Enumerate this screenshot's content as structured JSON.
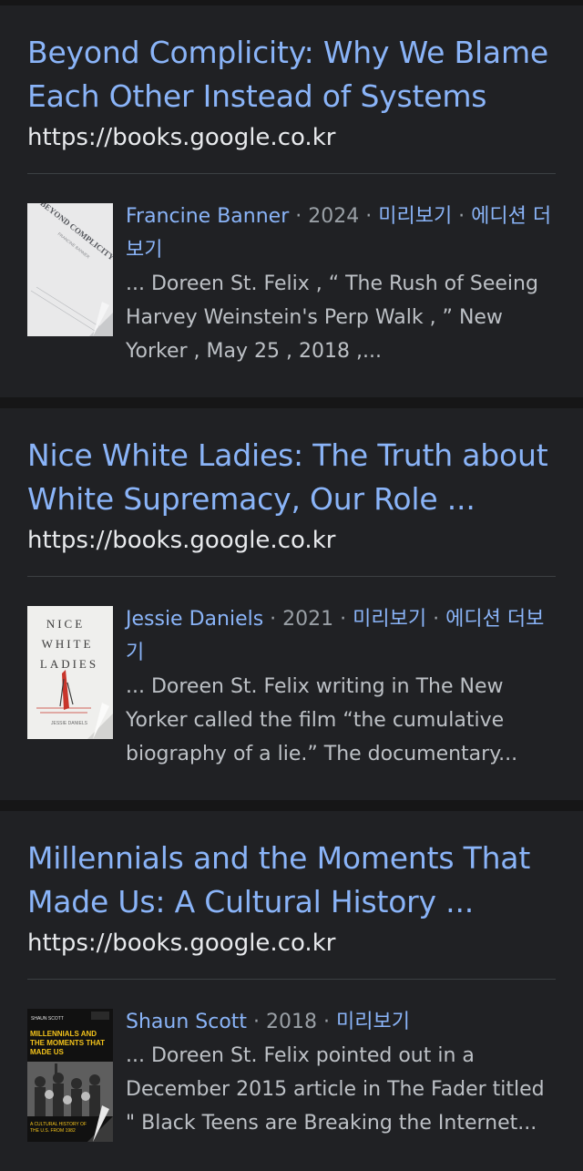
{
  "results": [
    {
      "title": "Beyond Complicity: Why We Blame Each Other Instead of Systems",
      "url": "https://books.google.co.kr",
      "author": "Francine Banner",
      "year": "2024",
      "preview_label": "미리보기",
      "editions_label": "에디션 더보기",
      "snippet": "... Doreen St. Felix , “ The Rush of Seeing Harvey Weinstein's Perp Walk , ” New Yorker , May 25 , 2018 ,...",
      "cover": {
        "title_text": "BEYOND COMPLICITY",
        "subtitle_text": "FRANCINE BANNER",
        "background": "#e9e9ea",
        "ink": "#55575c"
      }
    },
    {
      "title": "Nice White Ladies: The Truth about White Supremacy, Our Role ...",
      "url": "https://books.google.co.kr",
      "author": "Jessie Daniels",
      "year": "2021",
      "preview_label": "미리보기",
      "editions_label": "에디션 더보기",
      "snippet": "... Doreen St. Felix writing in The New Yorker called the film “the cumulative biography of a lie.” The documentary...",
      "cover": {
        "line1": "NICE",
        "line2": "WHITE",
        "line3": "LADIES",
        "author_text": "JESSIE DANIELS",
        "background": "#efefed",
        "ink": "#3b3b3b",
        "accent": "#c8352b"
      }
    },
    {
      "title": "Millennials and the Moments That Made Us: A Cultural History ...",
      "url": "https://books.google.co.kr",
      "author": "Shaun Scott",
      "year": "2018",
      "preview_label": "미리보기",
      "snippet": "... Doreen St. Felix pointed out in a December 2015 article in The Fader titled \" Black Teens are Breaking the Internet...",
      "cover": {
        "author_text": "SHAUN SCOTT",
        "title_lines": [
          "MILLENNIALS AND",
          "THE MOMENTS THAT",
          "MADE US"
        ],
        "footer_lines": [
          "A CULTURAL HISTORY OF",
          "THE U.S. FROM 1982"
        ],
        "background": "#111111",
        "accent": "#f2c21b"
      }
    }
  ],
  "colors": {
    "page_background": "#161617",
    "card_background": "#202124",
    "link": "#8ab4f8",
    "url_text": "#e8eaed",
    "meta_text": "#9aa0a6",
    "snippet_text": "#bdc1c6",
    "divider": "#3c4043"
  },
  "icons": {
    "cover_1": "book-cover-beyond-complicity",
    "cover_2": "book-cover-nice-white-ladies",
    "cover_3": "book-cover-millennials"
  }
}
